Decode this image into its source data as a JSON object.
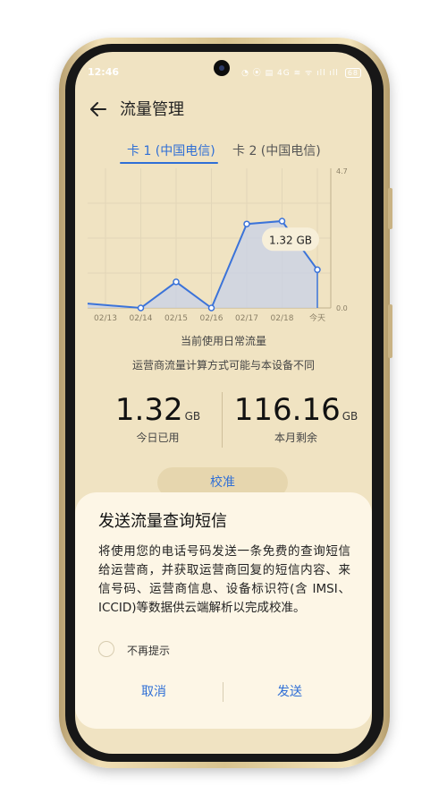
{
  "status_bar": {
    "time": "12:46",
    "indicators": "◔ ⦿ ▤ 4G ≋ ᯤ ıll ıll",
    "battery": "68"
  },
  "header": {
    "title": "流量管理"
  },
  "tabs": [
    {
      "label": "卡 1 (中国电信)",
      "selected": true
    },
    {
      "label": "卡 2 (中国电信)",
      "selected": false
    }
  ],
  "chart_data": {
    "type": "line",
    "categories": [
      "02/13",
      "02/14",
      "02/15",
      "02/16",
      "02/17",
      "02/18",
      "今天"
    ],
    "values": [
      0.2,
      0.0,
      0.9,
      0.0,
      2.9,
      3.0,
      1.32
    ],
    "y_tick_labels": [
      "4.7",
      "0.0"
    ],
    "ylim": [
      0,
      4.7
    ],
    "callout": "1.32 GB",
    "line_color": "#3b73d9",
    "area_color": "#c8d2e8"
  },
  "chart_caption": {
    "line1": "当前使用日常流量",
    "line2": "运营商流量计算方式可能与本设备不同"
  },
  "stats": {
    "today": {
      "value": "1.32",
      "unit": "GB",
      "label": "今日已用"
    },
    "month": {
      "value": "116.16",
      "unit": "GB",
      "label": "本月剩余"
    }
  },
  "calibrate_label": "校准",
  "dialog": {
    "title": "发送流量查询短信",
    "body": "将使用您的电话号码发送一条免费的查询短信给运营商，并获取运营商回复的短信内容、来信号码、运营商信息、设备标识符(含 IMSI、ICCID)等数据供云端解析以完成校准。",
    "checkbox_label": "不再提示",
    "cancel": "取消",
    "send": "发送"
  },
  "colors": {
    "accent": "#2f6fd6",
    "screen_bg": "#f0e3c2",
    "dialog_bg": "#fdf6e6"
  }
}
